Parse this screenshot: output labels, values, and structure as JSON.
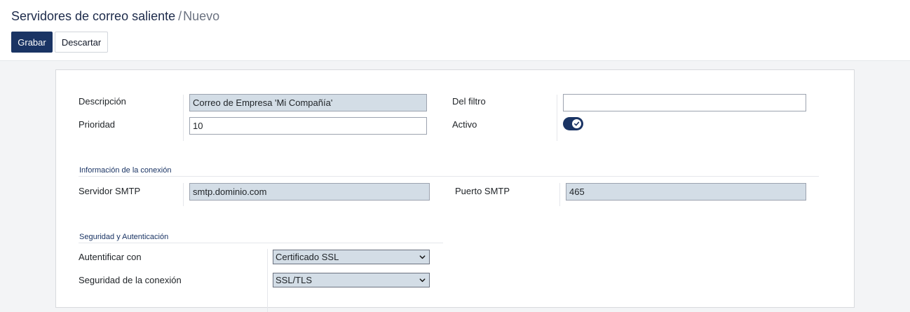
{
  "header": {
    "breadcrumb_parent": "Servidores de correo saliente",
    "breadcrumb_sep": "/",
    "breadcrumb_current": "Nuevo"
  },
  "toolbar": {
    "save_label": "Grabar",
    "discard_label": "Descartar"
  },
  "form": {
    "description": {
      "label": "Descripción",
      "value": "Correo de Empresa 'Mi Compañía'"
    },
    "priority": {
      "label": "Prioridad",
      "value": "10"
    },
    "from_filter": {
      "label": "Del filtro",
      "value": ""
    },
    "active": {
      "label": "Activo",
      "checked": true
    },
    "connection_section": "Información de la conexión",
    "smtp_server": {
      "label": "Servidor SMTP",
      "value": "smtp.dominio.com"
    },
    "smtp_port": {
      "label": "Puerto SMTP",
      "value": "465"
    },
    "security_section": "Seguridad y Autenticación",
    "auth_with": {
      "label": "Autentificar con",
      "value": "Certificado SSL"
    },
    "conn_security": {
      "label": "Seguridad de la conexión",
      "value": "SSL/TLS"
    }
  },
  "colors": {
    "primary": "#1a3464",
    "required_field_bg": "#d3dde6"
  }
}
